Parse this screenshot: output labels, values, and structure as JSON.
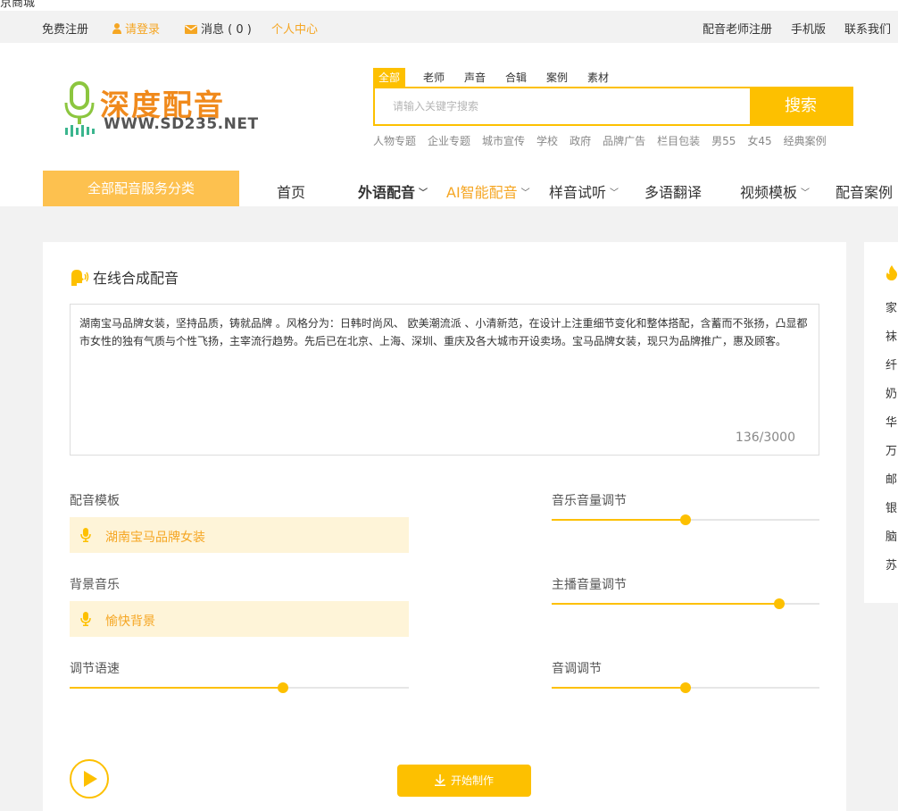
{
  "top_clip": {
    "text": "京商城"
  },
  "topbar": {
    "register": "免费注册",
    "login": "请登录",
    "messages": "消息 ( 0 )",
    "user_center": "个人中心",
    "teacher_register": "配音老师注册",
    "mobile": "手机版",
    "contact": "联系我们"
  },
  "logo": {
    "brand": "深度配音",
    "url": "WWW.SD235.NET"
  },
  "search": {
    "tabs": [
      "全部",
      "老师",
      "声音",
      "合辑",
      "案例",
      "素材"
    ],
    "active_tab": "全部",
    "placeholder": "请输入关键字搜索",
    "button": "搜索",
    "hot_words": [
      "人物专题",
      "企业专题",
      "城市宣传",
      "学校",
      "政府",
      "品牌广告",
      "栏目包装",
      "男55",
      "女45",
      "经典案例"
    ]
  },
  "nav": {
    "all_categories": "全部配音服务分类",
    "items": [
      {
        "label": "首页"
      },
      {
        "label": "外语配音"
      },
      {
        "label": "AI智能配音"
      },
      {
        "label": "样音试听"
      },
      {
        "label": "多语翻译"
      },
      {
        "label": "视频模板"
      },
      {
        "label": "配音案例"
      }
    ],
    "active": "AI智能配音"
  },
  "synth": {
    "title": "在线合成配音",
    "text": "湖南宝马品牌女装，坚持品质，铸就品牌 。风格分为：日韩时尚风、 欧美潮流派 、小清新范，在设计上注重细节变化和整体搭配，含蓄而不张扬，凸显都市女性的独有气质与个性飞扬，主宰流行趋势。先后已在北京、上海、深圳、重庆及各大城市开设卖场。宝马品牌女装，现只为品牌推广，惠及顾客。",
    "char_count": "136/3000",
    "template_label": "配音模板",
    "template_value": "湖南宝马品牌女装",
    "bgm_label": "背景音乐",
    "bgm_value": "愉快背景",
    "speed_label": "调节语速",
    "speed_level": 0.63,
    "music_volume_label": "音乐音量调节",
    "music_volume_level": 0.5,
    "host_volume_label": "主播音量调节",
    "host_volume_level": 0.85,
    "pitch_label": "音调调节",
    "pitch_level": 0.5,
    "start_button": "开始制作"
  },
  "side": {
    "items": [
      "家",
      "袜",
      "纤",
      "奶",
      "华",
      "万",
      "邮",
      "银",
      "脑",
      "苏"
    ]
  },
  "colors": {
    "accent": "#fdc000",
    "orange_text": "#f5a623",
    "nav_block": "#fdc14f",
    "pale_field": "#fef4d8"
  }
}
